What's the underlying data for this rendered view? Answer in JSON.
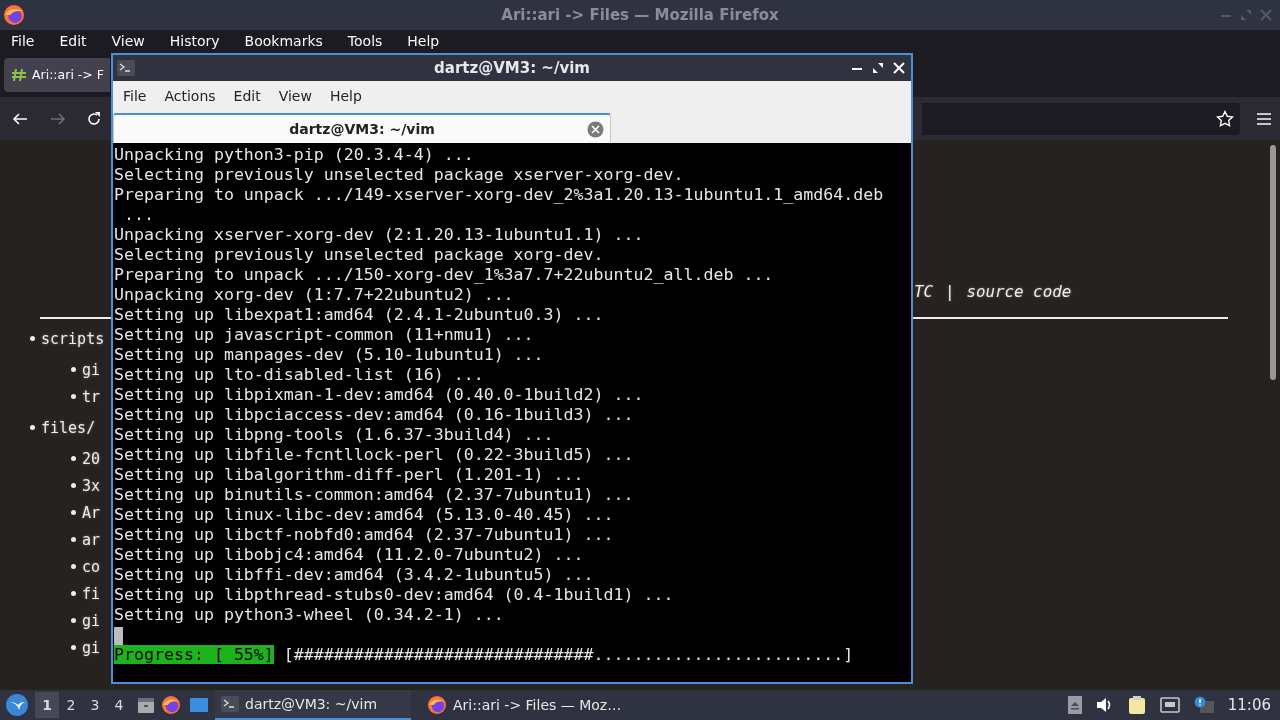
{
  "browser": {
    "title": "Ari::ari -> Files — Mozilla Firefox",
    "menu": [
      "File",
      "Edit",
      "View",
      "History",
      "Bookmarks",
      "Tools",
      "Help"
    ],
    "tab": {
      "label": "Ari::ari -> F"
    },
    "page": {
      "header_fragment": "TC",
      "separator": "|",
      "source_link": "source code",
      "items": [
        {
          "label": "scripts",
          "children": [
            {
              "label": "gi"
            },
            {
              "label": "tr"
            }
          ]
        },
        {
          "label": "files/",
          "children": [
            {
              "label": "20"
            },
            {
              "label": "3x"
            },
            {
              "label": "Ar"
            },
            {
              "label": "ar"
            },
            {
              "label": "co"
            },
            {
              "label": "fi"
            },
            {
              "label": "gi"
            },
            {
              "label": "gi"
            }
          ]
        }
      ]
    }
  },
  "terminal": {
    "title": "dartz@VM3: ~/vim",
    "menu": [
      "File",
      "Actions",
      "Edit",
      "View",
      "Help"
    ],
    "tabs": [
      {
        "label": "dartz@VM3: ~/vim",
        "selected": true
      }
    ],
    "lines": [
      "Unpacking python3-pip (20.3.4-4) ...",
      "Selecting previously unselected package xserver-xorg-dev.",
      "Preparing to unpack .../149-xserver-xorg-dev_2%3a1.20.13-1ubuntu1.1_amd64.deb",
      " ...",
      "Unpacking xserver-xorg-dev (2:1.20.13-1ubuntu1.1) ...",
      "Selecting previously unselected package xorg-dev.",
      "Preparing to unpack .../150-xorg-dev_1%3a7.7+22ubuntu2_all.deb ...",
      "Unpacking xorg-dev (1:7.7+22ubuntu2) ...",
      "Setting up libexpat1:amd64 (2.4.1-2ubuntu0.3) ...",
      "Setting up javascript-common (11+nmu1) ...",
      "Setting up manpages-dev (5.10-1ubuntu1) ...",
      "Setting up lto-disabled-list (16) ...",
      "Setting up libpixman-1-dev:amd64 (0.40.0-1build2) ...",
      "Setting up libpciaccess-dev:amd64 (0.16-1build3) ...",
      "Setting up libpng-tools (1.6.37-3build4) ...",
      "Setting up libfile-fcntllock-perl (0.22-3build5) ...",
      "Setting up libalgorithm-diff-perl (1.201-1) ...",
      "Setting up binutils-common:amd64 (2.37-7ubuntu1) ...",
      "Setting up linux-libc-dev:amd64 (5.13.0-40.45) ...",
      "Setting up libctf-nobfd0:amd64 (2.37-7ubuntu1) ...",
      "Setting up libobjc4:amd64 (11.2.0-7ubuntu2) ...",
      "Setting up libffi-dev:amd64 (3.4.2-1ubuntu5) ...",
      "Setting up libpthread-stubs0-dev:amd64 (0.4-1build1) ...",
      "Setting up python3-wheel (0.34.2-1) ..."
    ],
    "progress": {
      "label": "Progress: [ 55%]",
      "bar": "[##############################.........................]"
    }
  },
  "taskbar": {
    "workspaces": [
      {
        "label": "1",
        "selected": true
      },
      {
        "label": "2",
        "selected": false
      },
      {
        "label": "3",
        "selected": false
      },
      {
        "label": "4",
        "selected": false
      }
    ],
    "tasks": [
      {
        "label": "dartz@VM3: ~/vim",
        "kind": "terminal",
        "selected": true
      },
      {
        "label": "Ari::ari -> Files — Moz…",
        "kind": "browser",
        "selected": false
      }
    ],
    "clock": "11:06"
  }
}
